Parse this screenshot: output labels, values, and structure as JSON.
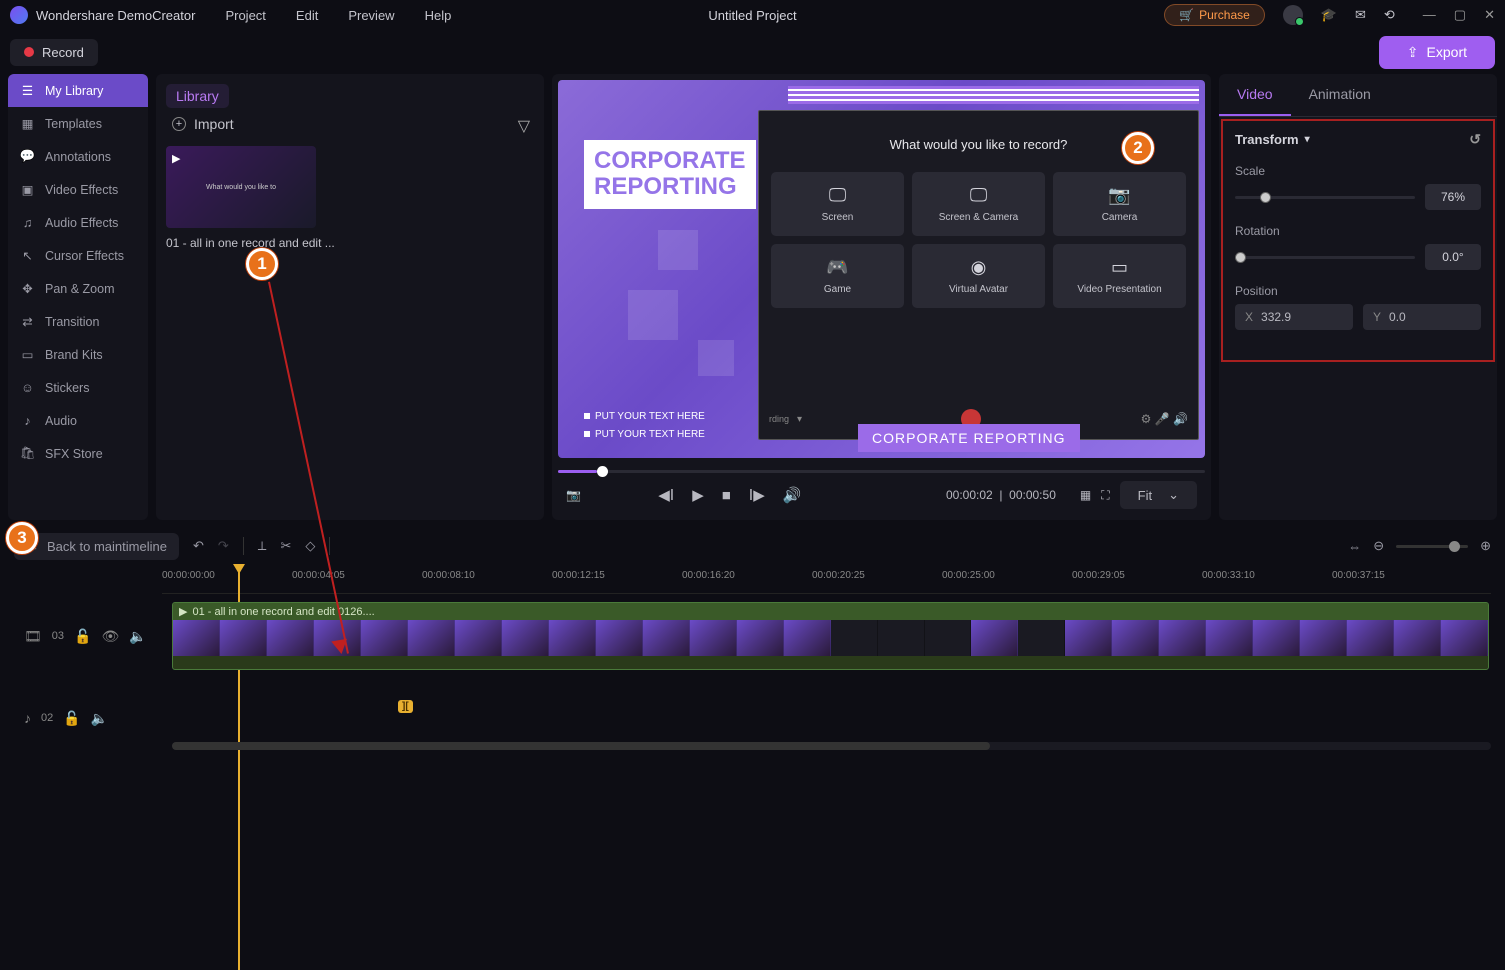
{
  "titlebar": {
    "appname": "Wondershare DemoCreator",
    "menu": [
      "Project",
      "Edit",
      "Preview",
      "Help"
    ],
    "project": "Untitled Project",
    "purchase": "Purchase"
  },
  "record_btn": "Record",
  "export_btn": "Export",
  "sidebar": {
    "items": [
      {
        "label": "My Library"
      },
      {
        "label": "Templates"
      },
      {
        "label": "Annotations"
      },
      {
        "label": "Video Effects"
      },
      {
        "label": "Audio Effects"
      },
      {
        "label": "Cursor Effects"
      },
      {
        "label": "Pan & Zoom"
      },
      {
        "label": "Transition"
      },
      {
        "label": "Brand Kits"
      },
      {
        "label": "Stickers"
      },
      {
        "label": "Audio"
      },
      {
        "label": "SFX Store"
      }
    ]
  },
  "library": {
    "tab": "Library",
    "import": "Import",
    "thumb_text": "What would you like to",
    "clip_name": "01 - all in one record and edit ..."
  },
  "preview": {
    "corp1": "CORPORATE",
    "corp2": "REPORTING",
    "put1": "PUT YOUR TEXT HERE",
    "put2": "PUT YOUR TEXT HERE",
    "rec_title": "What would you like to record?",
    "rec_cells": [
      "Screen",
      "Screen & Camera",
      "Camera",
      "Game",
      "Virtual Avatar",
      "Video Presentation"
    ],
    "rec_small": "rding",
    "corp_label": "CORPORATE REPORTING",
    "time_current": "00:00:02",
    "time_total": "00:00:50",
    "fit": "Fit"
  },
  "props": {
    "tabs": [
      "Video",
      "Animation"
    ],
    "transform": "Transform",
    "scale_label": "Scale",
    "scale_value": "76%",
    "rotation_label": "Rotation",
    "rotation_value": "0.0°",
    "position_label": "Position",
    "pos_x_label": "X",
    "pos_x": "332.9",
    "pos_y_label": "Y",
    "pos_y": "0.0"
  },
  "toolbar2": {
    "back": "Back to maintimeline"
  },
  "ruler": [
    "00:00:00:00",
    "00:00:04:05",
    "00:00:08:10",
    "00:00:12:15",
    "00:00:16:20",
    "00:00:20:25",
    "00:00:25:00",
    "00:00:29:05",
    "00:00:33:10",
    "00:00:37:15"
  ],
  "tracks": {
    "video_num": "03",
    "audio_num": "02",
    "clip_title": "01 - all in one record and edit 0126...."
  },
  "callouts": {
    "c1": "1",
    "c2": "2",
    "c3": "3"
  }
}
